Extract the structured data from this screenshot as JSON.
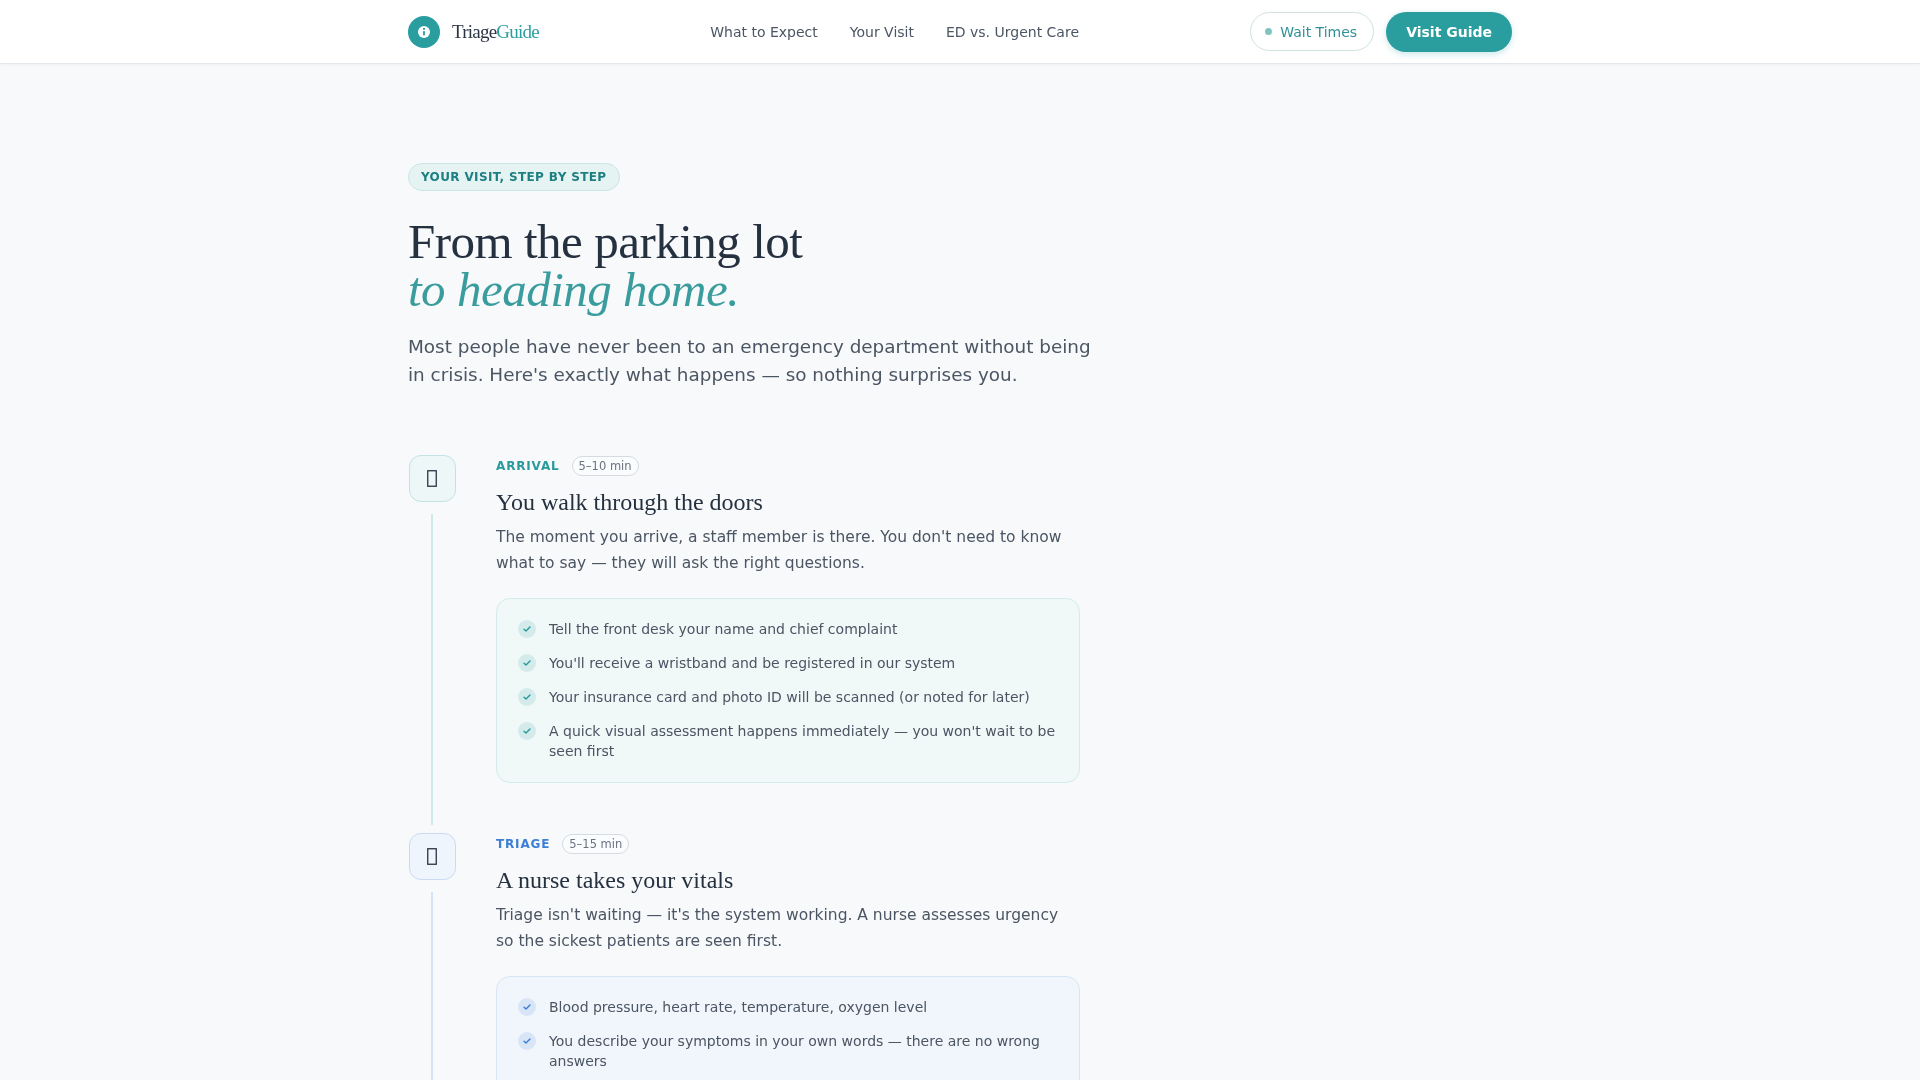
{
  "header": {
    "brand": {
      "name": "Triage",
      "accent": "Guide"
    },
    "nav": [
      "What to Expect",
      "Your Visit",
      "ED vs. Urgent Care"
    ],
    "wait_times_button": "Wait Times",
    "cta_button": "Visit Guide"
  },
  "hero": {
    "eyebrow": "YOUR VISIT, STEP BY STEP",
    "title": "From the parking lot",
    "title_accent": "to heading home.",
    "lead": "Most people have never been to an emergency department without being in crisis. Here's exactly what happens — so nothing surprises you."
  },
  "steps": [
    {
      "label": "ARRIVAL",
      "duration": "5–10 min",
      "color": "#2a9a9c",
      "title": "You walk through the doors",
      "description": "The moment you arrive, a staff member is there. You don't need to know what to say — they will ask the right questions.",
      "checklist": [
        "Tell the front desk your name and chief complaint",
        "You'll receive a wristband and be registered in our system",
        "Your insurance card and photo ID will be scanned (or noted for later)",
        "A quick visual assessment happens immediately — you won't wait to be seen first"
      ]
    },
    {
      "label": "TRIAGE",
      "duration": "5–15 min",
      "color": "#3d7fd4",
      "title": "A nurse takes your vitals",
      "description": "Triage isn't waiting — it's the system working. A nurse assesses urgency so the sickest patients are seen first.",
      "checklist": [
        "Blood pressure, heart rate, temperature, oxygen level",
        "You describe your symptoms in your own words — there are no wrong answers"
      ]
    }
  ]
}
